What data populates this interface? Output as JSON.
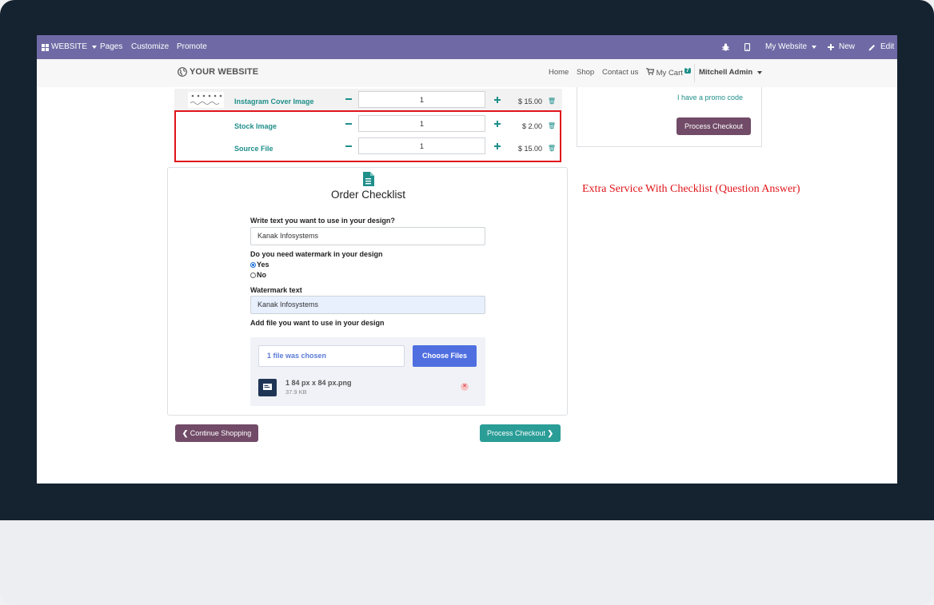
{
  "topbar": {
    "website": "WEBSITE",
    "pages": "Pages",
    "customize": "Customize",
    "promote": "Promote",
    "my_website": "My Website",
    "new": "New",
    "edit": "Edit"
  },
  "navbar": {
    "logo": "YOUR WEBSITE",
    "home": "Home",
    "shop": "Shop",
    "contact": "Contact us",
    "cart": "My Cart",
    "cart_count": "7",
    "user": "Mitchell Admin"
  },
  "cart": {
    "items": [
      {
        "name": "Instagram Cover Image",
        "qty": "1",
        "price": "$ 15.00"
      },
      {
        "name": "Stock Image",
        "qty": "1",
        "price": "$ 2.00"
      },
      {
        "name": "Source File",
        "qty": "1",
        "price": "$ 15.00"
      }
    ]
  },
  "summary": {
    "promo": "I have a promo code",
    "checkout": "Process Checkout"
  },
  "checklist": {
    "title": "Order Checklist",
    "q1": "Write text you want to use in your design?",
    "a1": "Kanak Infosystems",
    "q2": "Do you need watermark in your design",
    "yes": "Yes",
    "no": "No",
    "q3": "Watermark text",
    "a3": "Kanak Infosystems",
    "q4": "Add file you want to use in your design",
    "file_status": "1 file was chosen",
    "choose": "Choose Files",
    "file_name": "1 84 px x 84 px.png",
    "file_size": "37.9 KB"
  },
  "buttons": {
    "continue": "Continue Shopping",
    "checkout": "Process Checkout"
  },
  "annotation": "Extra Service With Checklist (Question Answer)"
}
